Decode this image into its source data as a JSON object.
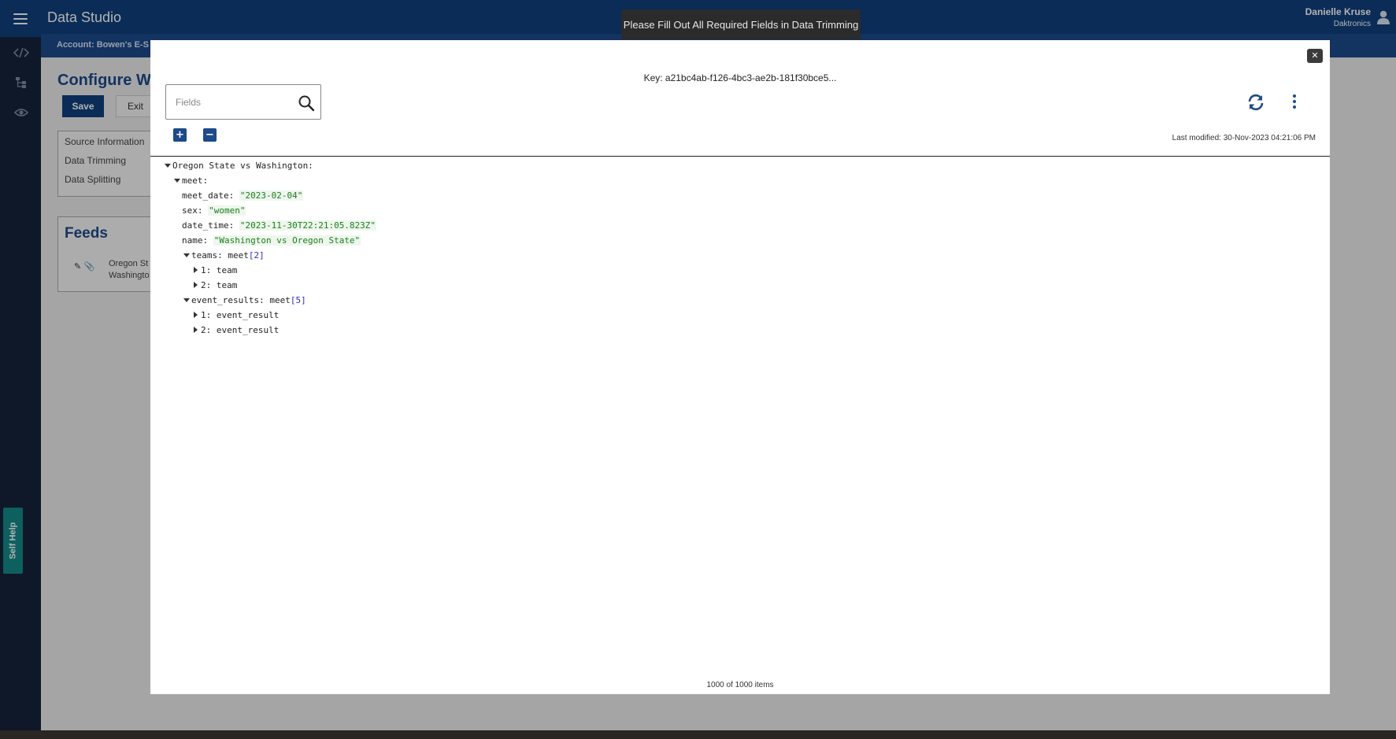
{
  "app": {
    "title": "Data Studio",
    "user_name": "Danielle Kruse",
    "user_org": "Daktronics",
    "account_label": "Account: Bowen's E-S"
  },
  "page": {
    "title": "Configure We",
    "save_label": "Save",
    "exit_label": "Exit",
    "steps": [
      "Source Information",
      "Data Trimming",
      "Data Splitting"
    ],
    "feeds_title": "Feeds",
    "feed_name_line1": "Oregon St",
    "feed_name_line2": "Washingto",
    "self_help_label": "Self Help"
  },
  "toast": {
    "message": "Please Fill Out All Required Fields in Data Trimming"
  },
  "modal": {
    "key_label": "Key: a21bc4ab-f126-4bc3-ae2b-181f30bce5...",
    "search_placeholder": "Fields",
    "expand_symbol": "+",
    "collapse_symbol": "−",
    "close_symbol": "✕",
    "last_modified": "Last modified: 30-Nov-2023 04:21:06 PM",
    "items_count": "1000 of 1000 items",
    "tree": {
      "root": "Oregon State vs Washington:",
      "meet": "meet:",
      "meet_date_key": "meet_date:",
      "meet_date_val": "\"2023-02-04\"",
      "sex_key": "sex:",
      "sex_val": "\"women\"",
      "date_time_key": "date_time:",
      "date_time_val": "\"2023-11-30T22:21:05.823Z\"",
      "name_key": "name:",
      "name_val": "\"Washington vs Oregon State\"",
      "teams_key": "teams: meet",
      "teams_count": "[2]",
      "team1": "1: team",
      "team2": "2: team",
      "events_key": "event_results: meet",
      "events_count": "[5]",
      "event1": "1: event_result",
      "event2": "2: event_result"
    }
  },
  "colors": {
    "brand": "#0f3f7d",
    "accent": "#1c4a8a",
    "string_value": "#1a7f1a",
    "count_value": "#2a2ad6",
    "self_help": "#148a8a"
  }
}
